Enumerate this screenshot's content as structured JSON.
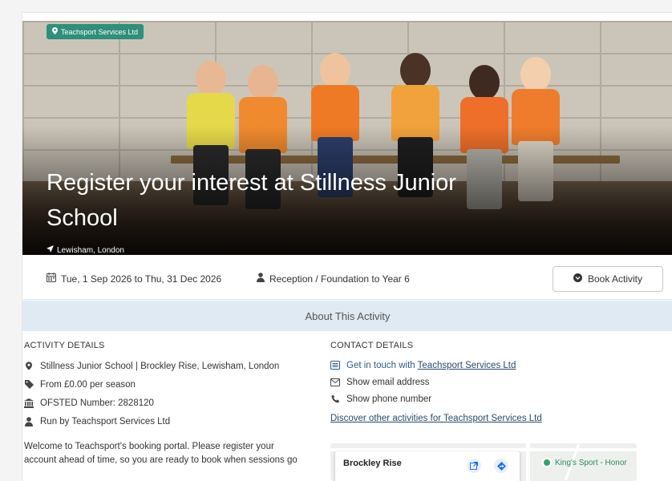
{
  "provider_badge": "Teachsport Services Ltd",
  "title": "Register your interest at Stillness Junior School",
  "location": "Lewisham, London",
  "date_range": "Tue, 1 Sep 2026 to Thu, 31 Dec 2026",
  "age_range": "Reception / Foundation to Year 6",
  "book_button": "Book Activity",
  "about_heading": "About This Activity",
  "activity_details": {
    "heading": "ACTIVITY DETAILS",
    "venue": "Stillness Junior School | Brockley Rise, Lewisham, London",
    "price": "From £0.00 per season",
    "ofsted": "OFSTED Number: 2828120",
    "run_by": "Run by Teachsport Services Ltd"
  },
  "contact_details": {
    "heading": "CONTACT DETAILS",
    "get_in_touch_prefix": "Get in touch with",
    "get_in_touch_link": "Teachsport Services Ltd",
    "show_email": "Show email address",
    "show_phone": "Show phone number",
    "discover_link": "Discover other activities for Teachsport Services Ltd"
  },
  "description": "Welcome to Teachsport's booking portal. Please register your account ahead of time, so you are ready to book when sessions go",
  "map": {
    "place_title": "Brockley Rise",
    "poi_label": "King's Sport - Honor"
  },
  "colors": {
    "badge": "#2e8f7a",
    "about_bar": "#dfeaf3",
    "link": "#2a5c8a"
  }
}
